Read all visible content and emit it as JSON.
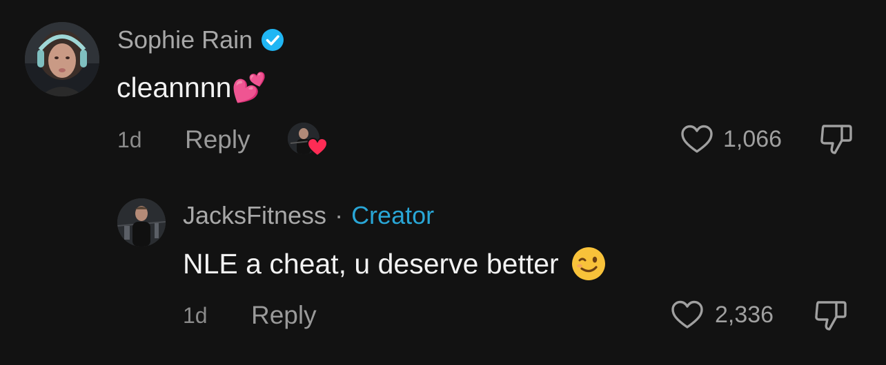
{
  "comments": [
    {
      "username": "Sophie Rain",
      "verified": true,
      "text": "cleannnn",
      "emoji": "💕",
      "age": "1d",
      "reply_label": "Reply",
      "creator_liked": true,
      "likes": "1,066"
    },
    {
      "username": "JacksFitness",
      "separator": "·",
      "badge": "Creator",
      "text": "NLE a cheat, u deserve better",
      "emoji": "😉",
      "age": "1d",
      "reply_label": "Reply",
      "likes": "2,336"
    }
  ],
  "colors": {
    "background": "#121212",
    "verified": "#20b6f4",
    "creator_badge": "#29a6d6",
    "creator_heart": "#fe2c55"
  }
}
